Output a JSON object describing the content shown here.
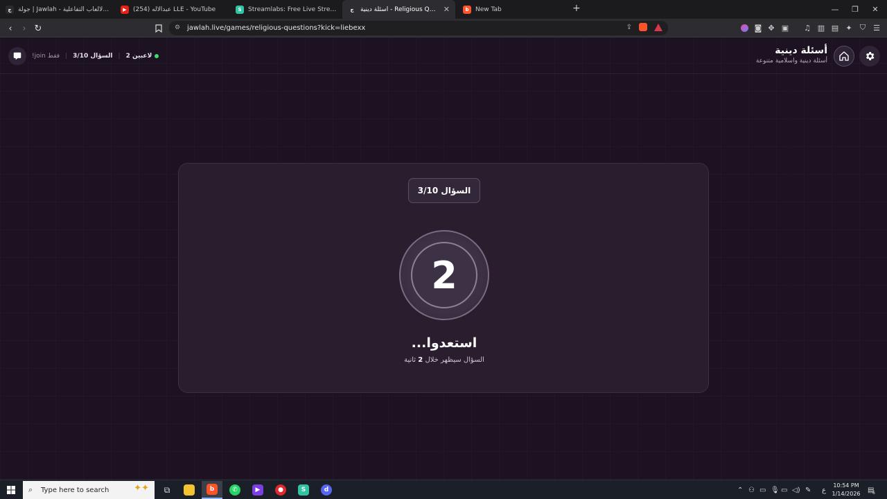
{
  "browser": {
    "tabs": [
      {
        "title": "جولة | Jawlah - منصة الألعاب التفاعلية",
        "icon": "jawlah-logo-icon",
        "active": false
      },
      {
        "title": "(254) عبدالاله LLE - YouTube",
        "icon": "youtube-icon",
        "active": false
      },
      {
        "title": "Streamlabs: Free Live Streaming & Re",
        "icon": "streamlabs-icon",
        "active": false
      },
      {
        "title": "أسئلة دينية - Religious Questions",
        "icon": "jawlah-logo-icon",
        "active": true
      },
      {
        "title": "New Tab",
        "icon": "brave-icon",
        "active": false
      }
    ],
    "close_tab_glyph": "✕",
    "new_tab_glyph": "+",
    "url": "jawlah.live/games/religious-questions?kick=liebexx"
  },
  "header": {
    "title": "أسئلة دينية",
    "subtitle": "أسئلة دينية واسلامية متنوعة",
    "players": "2 لاعبين",
    "question_progress": "السؤال 3/10",
    "join_hint": "!join فقط"
  },
  "card": {
    "badge": "السؤال 3/10",
    "countdown": "2",
    "ready_text": "استعدوا...",
    "sub_prefix": "السؤال سيظهر خلال",
    "sub_seconds": "2",
    "sub_suffix": "ثانية"
  },
  "taskbar": {
    "search_placeholder": "Type here to search",
    "time": "10:54 PM",
    "date": "1/14/2026",
    "lang": "ع",
    "notification_count": "6"
  },
  "colors": {
    "page_bg": "#1d1221",
    "card_bg": "#2a1e2e",
    "online_dot": "#3fdc6a"
  }
}
